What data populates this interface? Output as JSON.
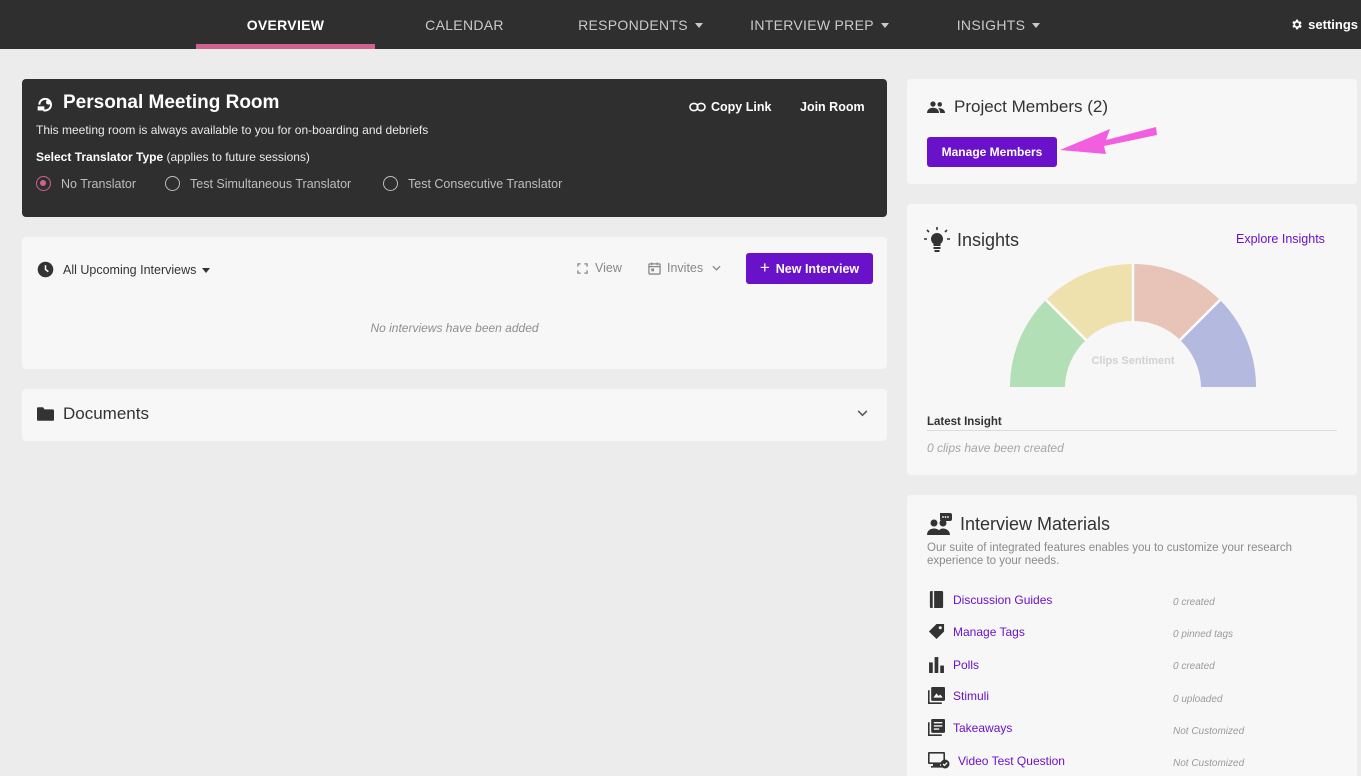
{
  "nav": {
    "items": [
      {
        "label": "OVERVIEW"
      },
      {
        "label": "CALENDAR"
      },
      {
        "label": "RESPONDENTS"
      },
      {
        "label": "INTERVIEW PREP"
      },
      {
        "label": "INSIGHTS"
      }
    ],
    "settings_label": "settings",
    "active_color": "#d0628f"
  },
  "meeting_room": {
    "title": "Personal Meeting Room",
    "description": "This meeting room is always available to you for on-boarding and debriefs",
    "translator_label": "Select Translator Type",
    "translator_note": "(applies to future sessions)",
    "options": [
      {
        "label": "No Translator",
        "checked": true
      },
      {
        "label": "Test Simultaneous Translator",
        "checked": false
      },
      {
        "label": "Test Consecutive Translator",
        "checked": false
      }
    ],
    "copy_link_label": "Copy Link",
    "join_room_label": "Join Room"
  },
  "interviews": {
    "filter_label": "All Upcoming Interviews",
    "view_label": "View",
    "invites_label": "Invites",
    "new_button_label": "New Interview",
    "empty_text": "No interviews have been added"
  },
  "documents": {
    "title": "Documents"
  },
  "project_members": {
    "title": "Project Members (2)",
    "manage_button_label": "Manage Members"
  },
  "insights": {
    "title": "Insights",
    "explore_label": "Explore Insights",
    "gauge_label": "Clips Sentiment",
    "gauge_colors": [
      "#b3dfb6",
      "#efe1ae",
      "#e8c3b7",
      "#b3b9df"
    ],
    "latest_label": "Latest Insight",
    "latest_empty": "0 clips have been created"
  },
  "materials": {
    "title": "Interview Materials",
    "description": "Our suite of integrated features enables you to customize your research experience to your needs.",
    "items": [
      {
        "icon": "book-icon",
        "label": "Discussion Guides",
        "status": "0 created"
      },
      {
        "icon": "tag-icon",
        "label": "Manage Tags",
        "status": "0 pinned tags"
      },
      {
        "icon": "bar-chart-icon",
        "label": "Polls",
        "status": "0 created"
      },
      {
        "icon": "image-icon",
        "label": "Stimuli",
        "status": "0 uploaded"
      },
      {
        "icon": "list-icon",
        "label": "Takeaways",
        "status": "Not Customized"
      },
      {
        "icon": "monitor-check-icon",
        "label": "Video Test Question",
        "status": "Not Customized"
      }
    ]
  },
  "accent_color": "#6a12c9"
}
